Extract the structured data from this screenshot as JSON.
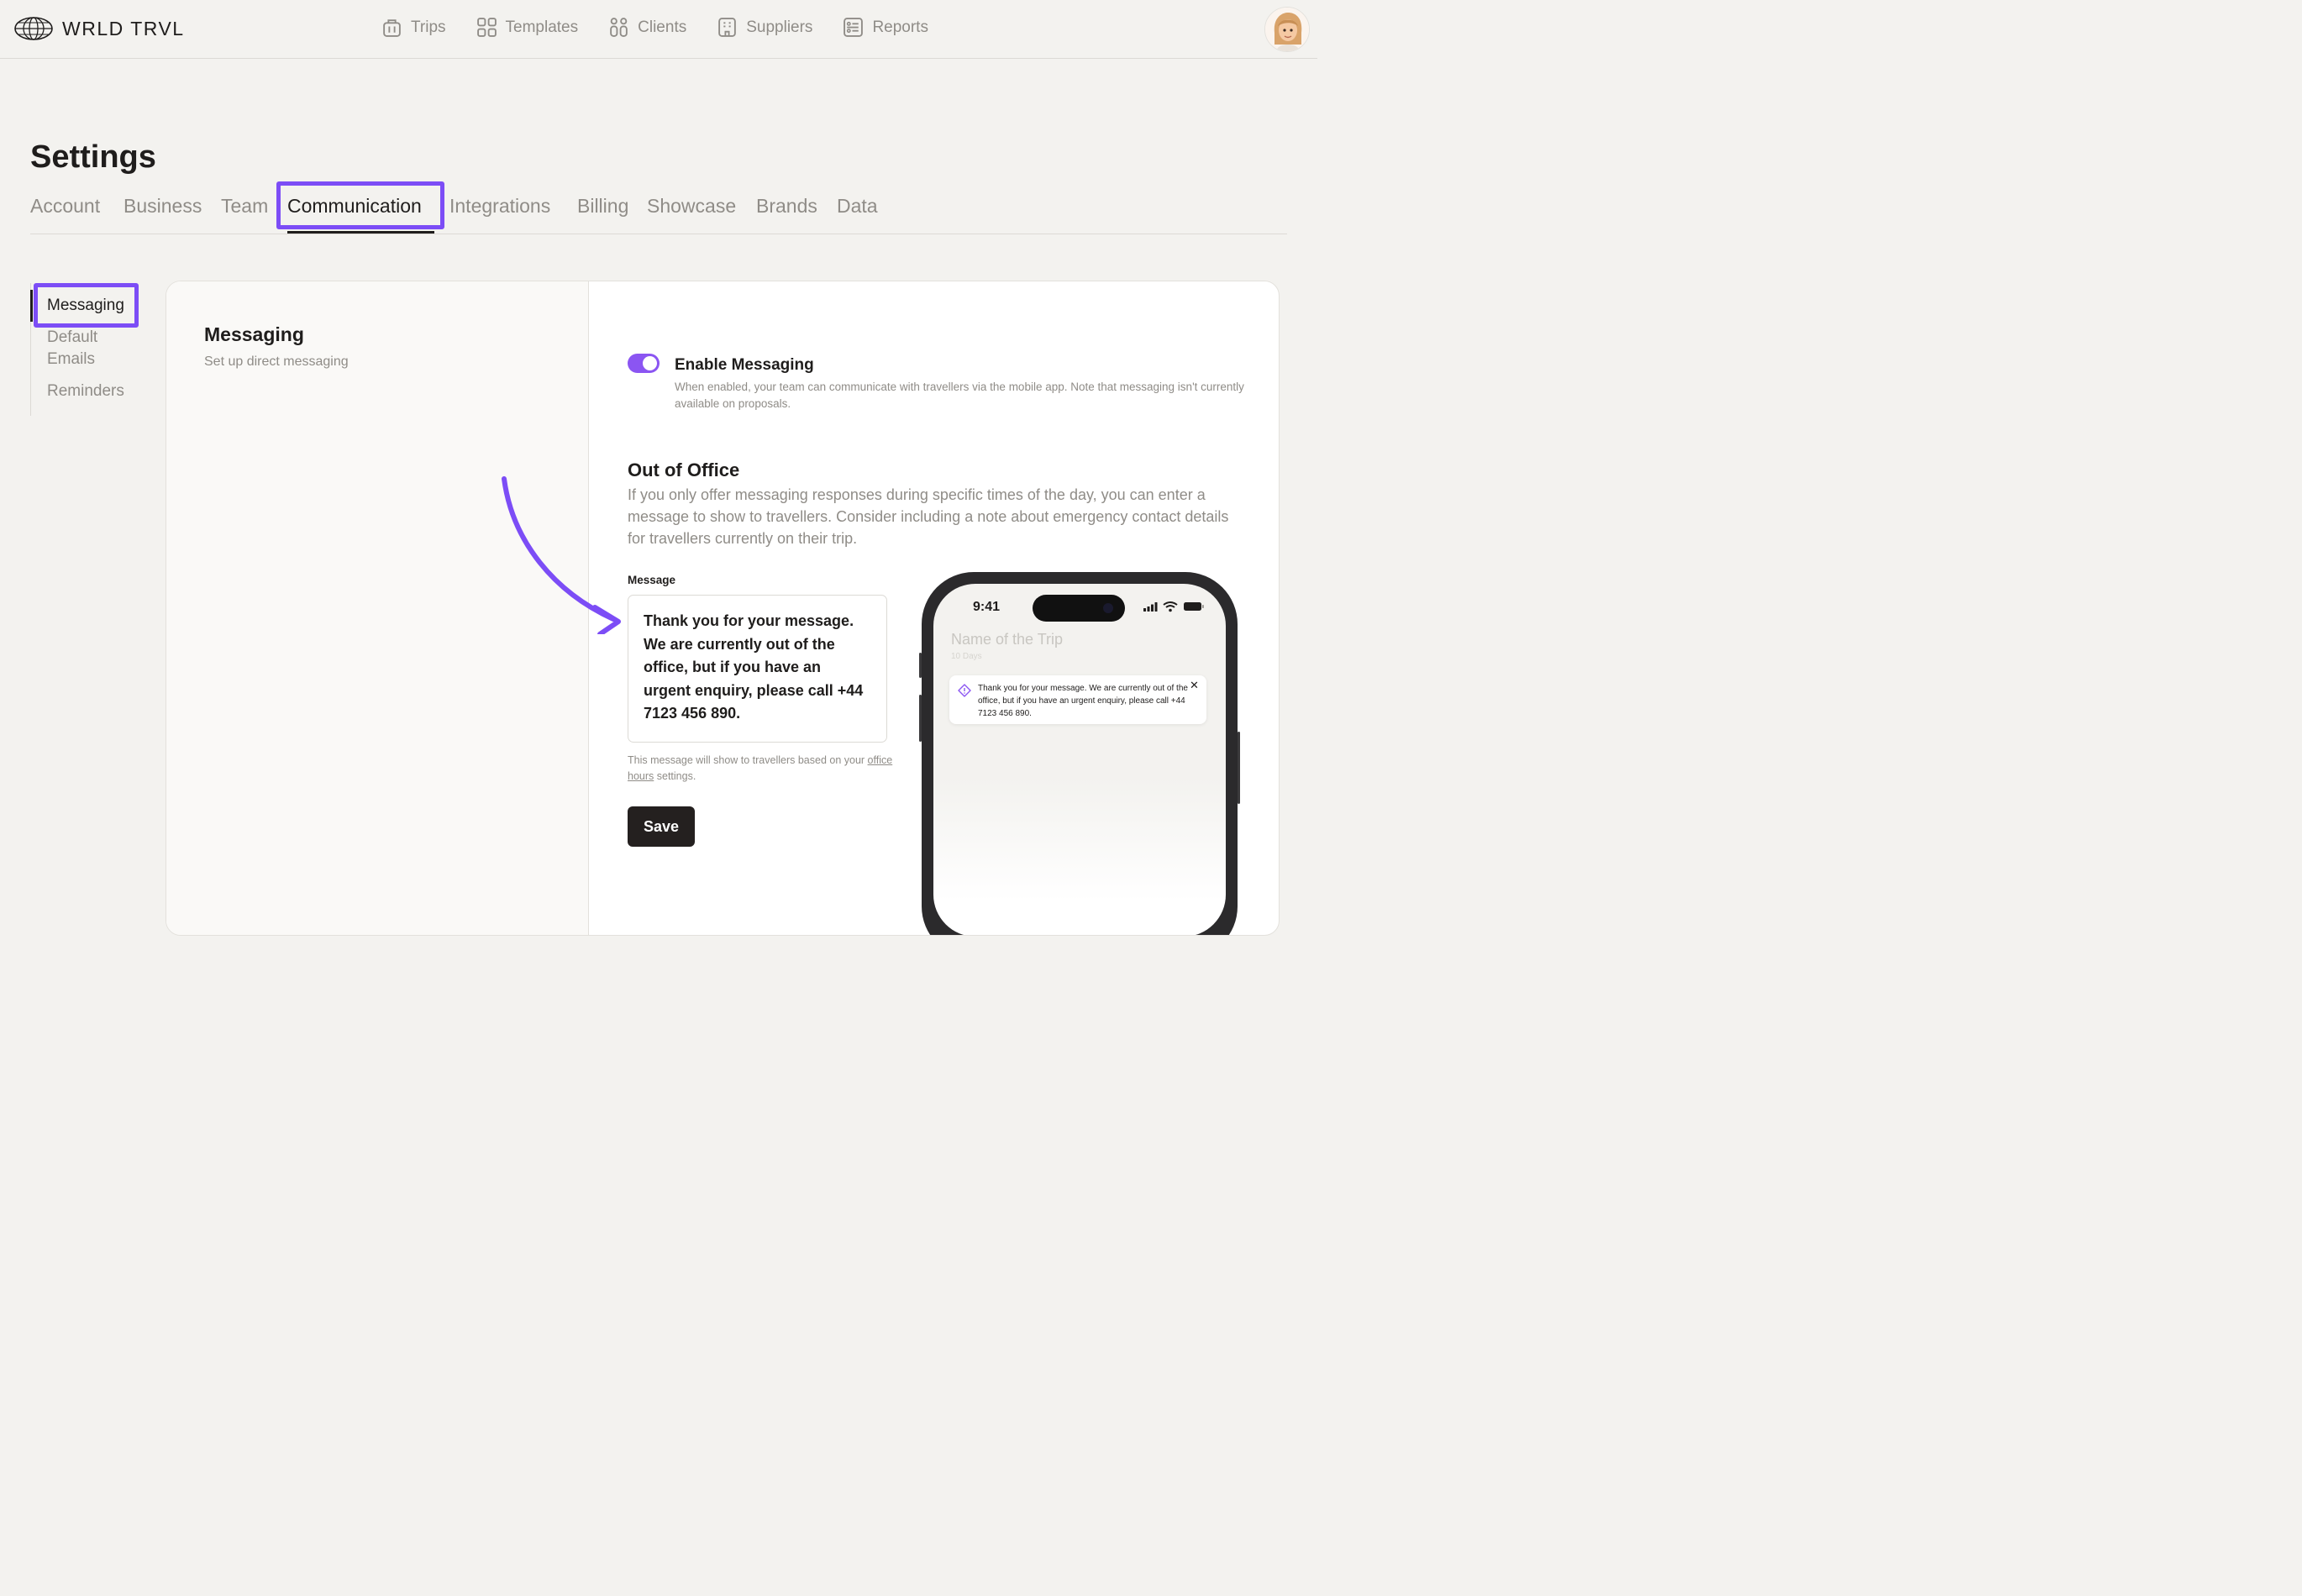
{
  "brand": {
    "name": "WRLD TRVL"
  },
  "nav": [
    {
      "label": "Trips",
      "icon": "suitcase-icon"
    },
    {
      "label": "Templates",
      "icon": "grid-icon"
    },
    {
      "label": "Clients",
      "icon": "people-icon"
    },
    {
      "label": "Suppliers",
      "icon": "building-icon"
    },
    {
      "label": "Reports",
      "icon": "report-icon"
    }
  ],
  "page": {
    "title": "Settings"
  },
  "tabs": [
    "Account",
    "Business",
    "Team",
    "Communication",
    "Integrations",
    "Billing",
    "Showcase",
    "Brands",
    "Data"
  ],
  "active_tab": "Communication",
  "sidenav": [
    "Messaging",
    "Default Emails",
    "Reminders"
  ],
  "active_side": "Messaging",
  "section": {
    "title": "Messaging",
    "subtitle": "Set up direct messaging"
  },
  "enable_messaging": {
    "enabled": true,
    "label": "Enable Messaging",
    "description": "When enabled, your team can communicate with travellers via the mobile app. Note that messaging isn't currently available on proposals."
  },
  "out_of_office": {
    "title": "Out of Office",
    "description": "If you only offer messaging responses during specific times of the day, you can enter a message to show to travellers. Consider including a note about emergency contact details for travellers currently on their trip.",
    "message_label": "Message",
    "message_value": "Thank you for your message. We are currently out of the office, but if you have an urgent enquiry, please call +44 7123 456 890.",
    "help_before": "This message will show to travellers based on your ",
    "help_link": "office hours",
    "help_after": " settings.",
    "save_label": "Save"
  },
  "phone": {
    "time": "9:41",
    "trip_name": "Name of the Trip",
    "trip_days": "10 Days",
    "toast_text": "Thank you for your message. We are currently out of the office, but if you have an urgent enquiry, please call +44 7123 456 890.",
    "close_glyph": "✕"
  },
  "colors": {
    "accent": "#7c4df6",
    "toggle": "#8b55f2",
    "button": "#24201f",
    "background": "#f3f2ef"
  }
}
